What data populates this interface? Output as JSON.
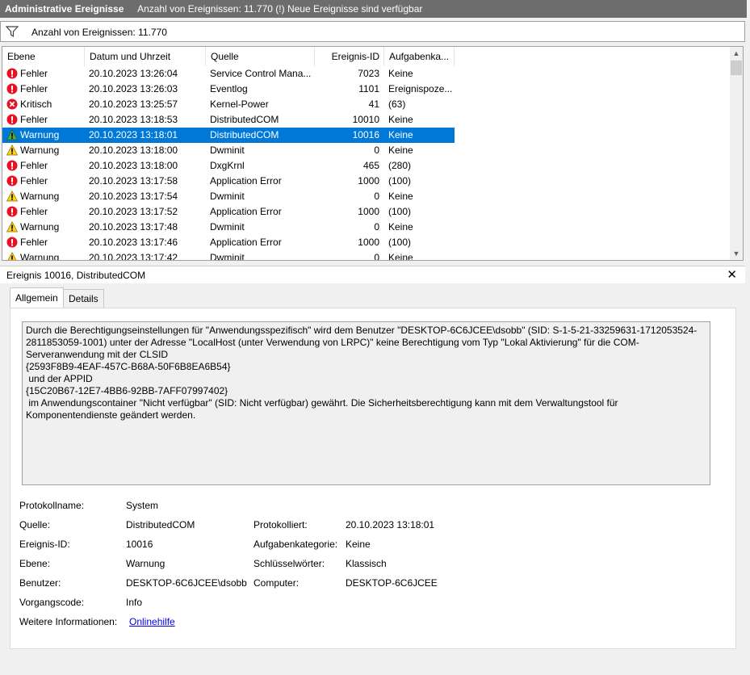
{
  "title": {
    "name": "Administrative Ereignisse",
    "info": "Anzahl von Ereignissen: 11.770 (!) Neue Ereignisse sind verfügbar"
  },
  "filter": {
    "text": "Anzahl von Ereignissen: 11.770"
  },
  "list": {
    "columns": [
      "Ebene",
      "Datum und Uhrzeit",
      "Quelle",
      "Ereignis-ID",
      "Aufgabenka..."
    ],
    "rows": [
      {
        "level": "Fehler",
        "icon": "error-icon",
        "date": "20.10.2023 13:26:04",
        "source": "Service Control Mana...",
        "id": "7023",
        "cat": "Keine"
      },
      {
        "level": "Fehler",
        "icon": "error-icon",
        "date": "20.10.2023 13:26:03",
        "source": "Eventlog",
        "id": "1101",
        "cat": "Ereignispoze..."
      },
      {
        "level": "Kritisch",
        "icon": "critical-icon",
        "date": "20.10.2023 13:25:57",
        "source": "Kernel-Power",
        "id": "41",
        "cat": "(63)"
      },
      {
        "level": "Fehler",
        "icon": "error-icon",
        "date": "20.10.2023 13:18:53",
        "source": "DistributedCOM",
        "id": "10010",
        "cat": "Keine"
      },
      {
        "level": "Warnung",
        "icon": "warning-icon",
        "date": "20.10.2023 13:18:01",
        "source": "DistributedCOM",
        "id": "10016",
        "cat": "Keine",
        "selected": true
      },
      {
        "level": "Warnung",
        "icon": "warning-icon",
        "date": "20.10.2023 13:18:00",
        "source": "Dwminit",
        "id": "0",
        "cat": "Keine"
      },
      {
        "level": "Fehler",
        "icon": "error-icon",
        "date": "20.10.2023 13:18:00",
        "source": "DxgKrnl",
        "id": "465",
        "cat": "(280)"
      },
      {
        "level": "Fehler",
        "icon": "error-icon",
        "date": "20.10.2023 13:17:58",
        "source": "Application Error",
        "id": "1000",
        "cat": "(100)"
      },
      {
        "level": "Warnung",
        "icon": "warning-icon",
        "date": "20.10.2023 13:17:54",
        "source": "Dwminit",
        "id": "0",
        "cat": "Keine"
      },
      {
        "level": "Fehler",
        "icon": "error-icon",
        "date": "20.10.2023 13:17:52",
        "source": "Application Error",
        "id": "1000",
        "cat": "(100)"
      },
      {
        "level": "Warnung",
        "icon": "warning-icon",
        "date": "20.10.2023 13:17:48",
        "source": "Dwminit",
        "id": "0",
        "cat": "Keine"
      },
      {
        "level": "Fehler",
        "icon": "error-icon",
        "date": "20.10.2023 13:17:46",
        "source": "Application Error",
        "id": "1000",
        "cat": "(100)"
      },
      {
        "level": "Warnung",
        "icon": "warning-icon",
        "date": "20.10.2023 13:17:42",
        "source": "Dwminit",
        "id": "0",
        "cat": "Keine"
      }
    ]
  },
  "detail": {
    "header": "Ereignis 10016, DistributedCOM",
    "tabs": [
      "Allgemein",
      "Details"
    ],
    "description": "Durch die Berechtigungseinstellungen für \"Anwendungsspezifisch\" wird dem Benutzer \"DESKTOP-6C6JCEE\\dsobb\" (SID: S-1-5-21-33259631-1712053524-2811853059-1001) unter der Adresse \"LocalHost (unter Verwendung von LRPC)\" keine Berechtigung vom Typ \"Lokal Aktivierung\" für die COM-Serveranwendung mit der CLSID\n{2593F8B9-4EAF-457C-B68A-50F6B8EA6B54}\n und der APPID\n{15C20B67-12E7-4BB6-92BB-7AFF07997402}\n im Anwendungscontainer \"Nicht verfügbar\" (SID: Nicht verfügbar) gewährt. Die Sicherheitsberechtigung kann mit dem Verwaltungstool für Komponentendienste geändert werden.",
    "props": {
      "log_label": "Protokollname:",
      "log_value": "System",
      "source_label": "Quelle:",
      "source_value": "DistributedCOM",
      "logged_label": "Protokolliert:",
      "logged_value": "20.10.2023 13:18:01",
      "eventid_label": "Ereignis-ID:",
      "eventid_value": "10016",
      "taskcat_label": "Aufgabenkategorie:",
      "taskcat_value": "Keine",
      "level_label": "Ebene:",
      "level_value": "Warnung",
      "keywords_label": "Schlüsselwörter:",
      "keywords_value": "Klassisch",
      "user_label": "Benutzer:",
      "user_value": "DESKTOP-6C6JCEE\\dsobb",
      "computer_label": "Computer:",
      "computer_value": "DESKTOP-6C6JCEE",
      "opcode_label": "Vorgangscode:",
      "opcode_value": "Info",
      "moreinfo_label": "Weitere Informationen:",
      "moreinfo_link": "Onlinehilfe"
    }
  },
  "colors": {
    "selection": "#0078d7",
    "error": "#e81123",
    "warning": "#fcd116",
    "titlebar": "#6d6d6d"
  }
}
